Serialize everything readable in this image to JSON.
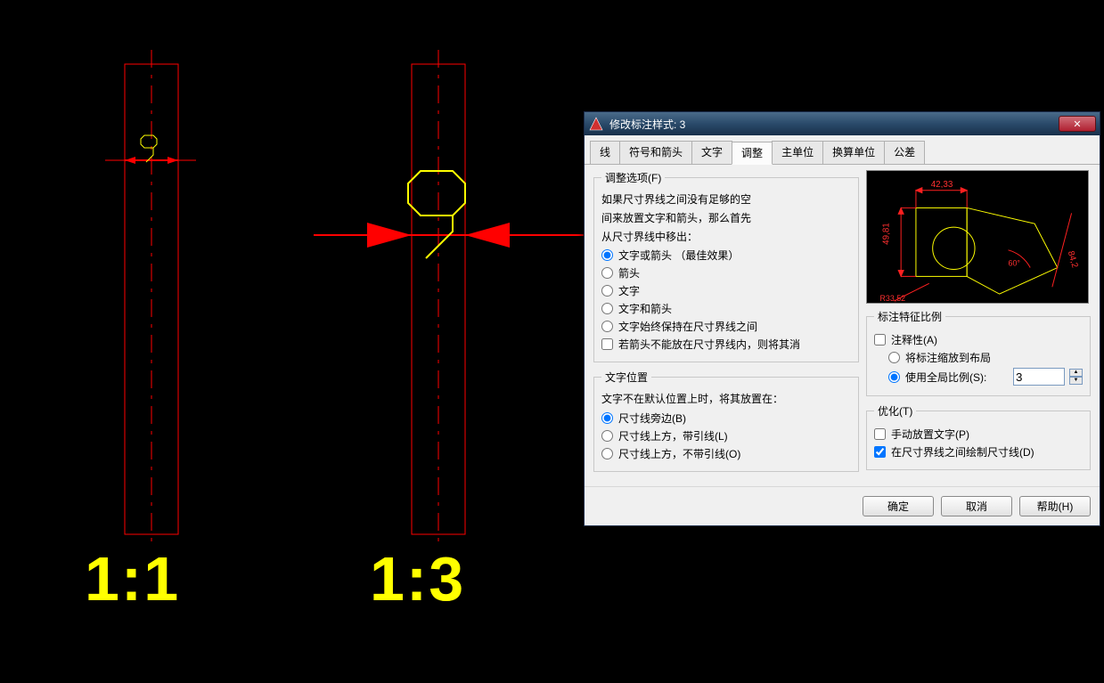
{
  "canvas": {
    "dim_left": "9",
    "dim_right": "9",
    "scale_left": "1:1",
    "scale_right": "1:3"
  },
  "dialog": {
    "title": "修改标注样式: 3",
    "close_glyph": "✕",
    "tabs": {
      "line": "线",
      "symbols": "符号和箭头",
      "text": "文字",
      "fit": "调整",
      "primary": "主单位",
      "alt": "换算单位",
      "tol": "公差"
    },
    "fit_options": {
      "legend": "调整选项(F)",
      "intro1": "如果尺寸界线之间没有足够的空",
      "intro2": "间来放置文字和箭头，那么首先",
      "intro3": "从尺寸界线中移出：",
      "r_best": "文字或箭头 （最佳效果）",
      "r_arrows": "箭头",
      "r_text": "文字",
      "r_both": "文字和箭头",
      "r_keep": "文字始终保持在尺寸界线之间",
      "c_suppress": "若箭头不能放在尺寸界线内，则将其消"
    },
    "text_pos": {
      "legend": "文字位置",
      "intro": "文字不在默认位置上时，将其放置在：",
      "r_beside": "尺寸线旁边(B)",
      "r_over_leader": "尺寸线上方，带引线(L)",
      "r_over_noleader": "尺寸线上方，不带引线(O)"
    },
    "scale": {
      "legend": "标注特征比例",
      "c_annot": "注释性(A)",
      "r_layout": "将标注缩放到布局",
      "r_global": "使用全局比例(S):",
      "value": "3"
    },
    "tune": {
      "legend": "优化(T)",
      "c_manual": "手动放置文字(P)",
      "c_drawline": "在尺寸界线之间绘制尺寸线(D)"
    },
    "buttons": {
      "ok": "确定",
      "cancel": "取消",
      "help": "帮助(H)"
    },
    "preview": {
      "d_top": "42,33",
      "d_left": "49,81",
      "d_right": "84,2",
      "d_ang": "60°",
      "d_rad": "R33,52"
    }
  }
}
